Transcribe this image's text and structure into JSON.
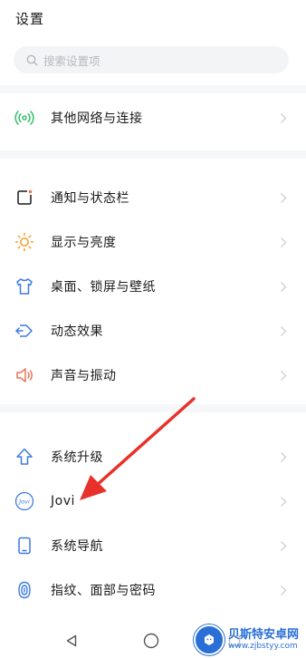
{
  "page": {
    "title": "设置"
  },
  "search": {
    "placeholder": "搜索设置项",
    "icon": "search-icon"
  },
  "colors": {
    "network_icon": "#3ac46e",
    "notify_icon": "#2f6bd9",
    "display_icon": "#f2a43a",
    "desktop_icon": "#3d7be0",
    "dynamic_icon": "#3d7be0",
    "sound_icon": "#e8765a",
    "accent_blue": "#3d7be0",
    "arrow_red": "#e8312b",
    "watermark": "#2a6fd6"
  },
  "settings": {
    "items": [
      {
        "label": "其他网络与连接",
        "icon": "network-icon"
      },
      {
        "label": "通知与状态栏",
        "icon": "notification-icon"
      },
      {
        "label": "显示与亮度",
        "icon": "brightness-icon"
      },
      {
        "label": "桌面、锁屏与壁纸",
        "icon": "wallpaper-icon"
      },
      {
        "label": "动态效果",
        "icon": "animation-icon"
      },
      {
        "label": "声音与振动",
        "icon": "sound-icon"
      },
      {
        "label": "系统升级",
        "icon": "upgrade-icon"
      },
      {
        "label": "Jovi",
        "icon": "jovi-icon"
      },
      {
        "label": "系统导航",
        "icon": "navigation-icon"
      },
      {
        "label": "指纹、面部与密码",
        "icon": "fingerprint-icon"
      }
    ]
  },
  "navbar": {
    "back": "back-icon",
    "home": "home-icon",
    "recent": "recent-icon"
  },
  "watermark": {
    "name": "贝斯特安卓网",
    "url": "www.zjbstyy.com"
  }
}
